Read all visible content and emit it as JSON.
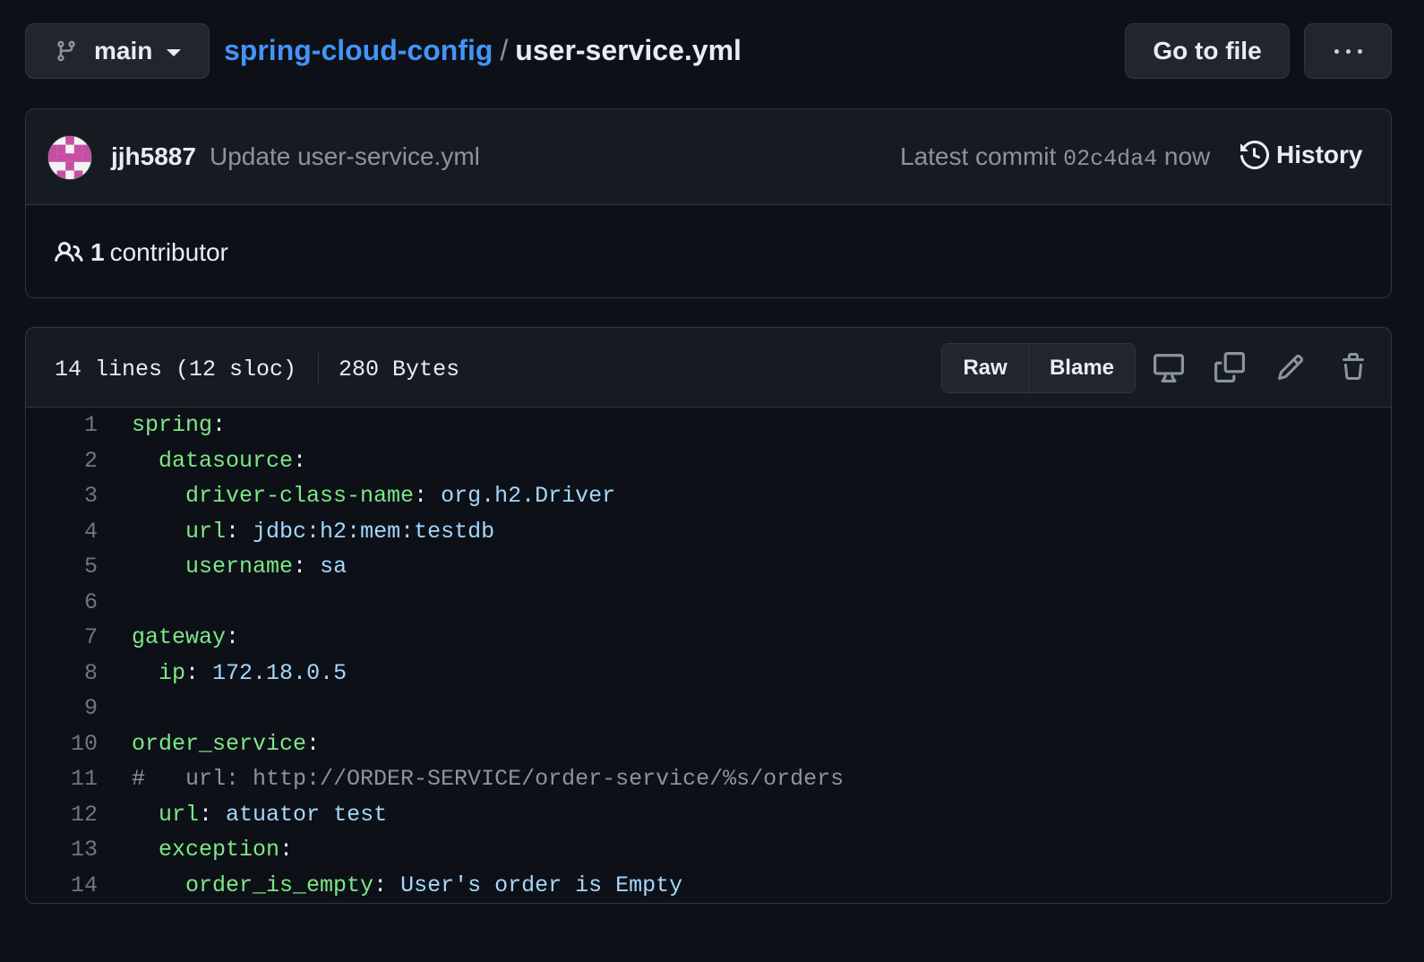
{
  "branch": {
    "name": "main"
  },
  "breadcrumb": {
    "repo": "spring-cloud-config",
    "separator": "/",
    "file": "user-service.yml"
  },
  "actions": {
    "goto_file": "Go to file"
  },
  "commit": {
    "author": "jjh5887",
    "message": "Update user-service.yml",
    "latest_label": "Latest commit",
    "sha": "02c4da4",
    "time": "now",
    "history_label": "History"
  },
  "contributors": {
    "count": "1",
    "label": "contributor"
  },
  "file": {
    "lines_info": "14 lines (12 sloc)",
    "size": "280 Bytes",
    "raw_label": "Raw",
    "blame_label": "Blame",
    "lines": [
      {
        "num": "1",
        "indent": "",
        "key": "spring",
        "sep": ":",
        "value": ""
      },
      {
        "num": "2",
        "indent": "  ",
        "key": "datasource",
        "sep": ":",
        "value": ""
      },
      {
        "num": "3",
        "indent": "    ",
        "key": "driver-class-name",
        "sep": ": ",
        "value": "org.h2.Driver"
      },
      {
        "num": "4",
        "indent": "    ",
        "key": "url",
        "sep": ": ",
        "value": "jdbc:h2:mem:testdb"
      },
      {
        "num": "5",
        "indent": "    ",
        "key": "username",
        "sep": ": ",
        "value": "sa"
      },
      {
        "num": "6",
        "indent": "",
        "key": "",
        "sep": "",
        "value": ""
      },
      {
        "num": "7",
        "indent": "",
        "key": "gateway",
        "sep": ":",
        "value": ""
      },
      {
        "num": "8",
        "indent": "  ",
        "key": "ip",
        "sep": ": ",
        "value": "172.18.0.5"
      },
      {
        "num": "9",
        "indent": "",
        "key": "",
        "sep": "",
        "value": ""
      },
      {
        "num": "10",
        "indent": "",
        "key": "order_service",
        "sep": ":",
        "value": ""
      },
      {
        "num": "11",
        "comment": "#   url: http://ORDER-SERVICE/order-service/%s/orders"
      },
      {
        "num": "12",
        "indent": "  ",
        "key": "url",
        "sep": ": ",
        "value": "atuator test"
      },
      {
        "num": "13",
        "indent": "  ",
        "key": "exception",
        "sep": ":",
        "value": ""
      },
      {
        "num": "14",
        "indent": "    ",
        "key": "order_is_empty",
        "sep": ": ",
        "value": "User's order is Empty"
      }
    ]
  },
  "colors": {
    "background": "#0d1117",
    "link": "#4493f8",
    "yaml_key": "#7ee787",
    "yaml_value": "#a5d6ff",
    "comment": "#8b949e"
  }
}
